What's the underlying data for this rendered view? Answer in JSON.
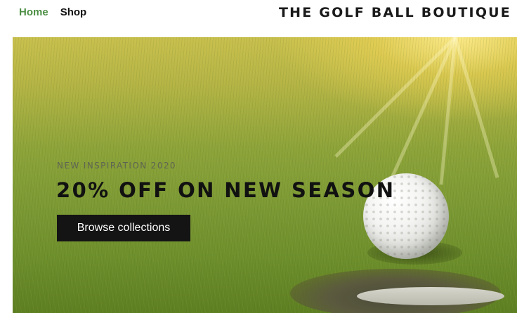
{
  "nav": {
    "items": [
      {
        "label": "Home",
        "active": true
      },
      {
        "label": "Shop",
        "active": false
      }
    ],
    "active_color": "#4d8f45"
  },
  "site": {
    "title": "THE GOLF BALL BOUTIQUE"
  },
  "hero": {
    "kicker": "NEW INSPIRATION 2020",
    "headline": "20% OFF ON NEW SEASON",
    "cta_label": "Browse collections",
    "image": "golf-ball-near-hole-on-green"
  }
}
